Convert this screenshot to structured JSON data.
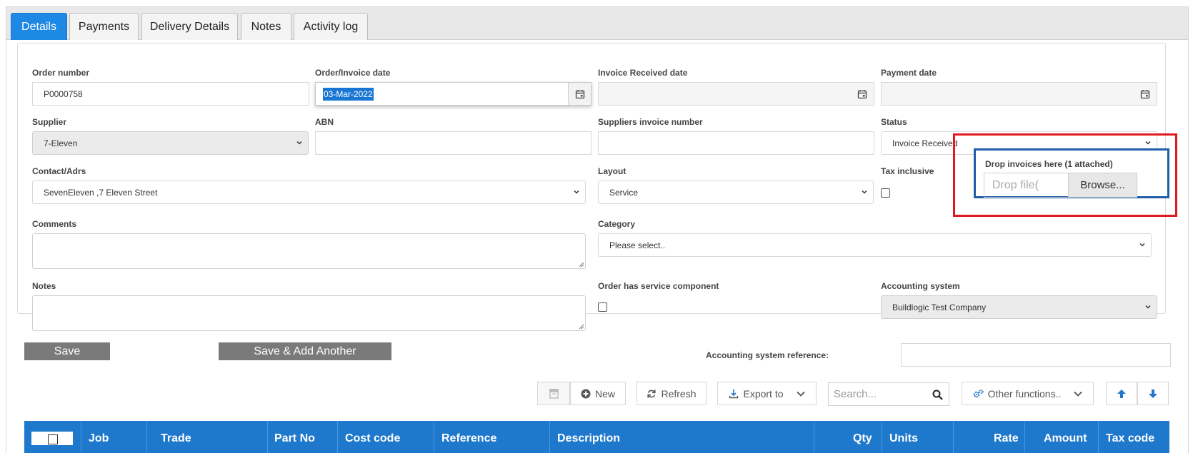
{
  "tabs": [
    "Details",
    "Payments",
    "Delivery Details",
    "Notes",
    "Activity log"
  ],
  "form": {
    "order_number": {
      "label": "Order number",
      "value": "P0000758"
    },
    "invoice_date": {
      "label": "Order/Invoice date",
      "value": "03-Mar-2022"
    },
    "received_date": {
      "label": "Invoice Received date",
      "value": ""
    },
    "payment_date": {
      "label": "Payment date",
      "value": ""
    },
    "supplier": {
      "label": "Supplier",
      "value": "7-Eleven"
    },
    "abn": {
      "label": "ABN",
      "value": ""
    },
    "supplier_invoice": {
      "label": "Suppliers invoice number",
      "value": ""
    },
    "status": {
      "label": "Status",
      "value": "Invoice Received"
    },
    "contact": {
      "label": "Contact/Adrs",
      "value": "SevenEleven ,7 Eleven Street"
    },
    "layout": {
      "label": "Layout",
      "value": "Service"
    },
    "tax_inclusive": {
      "label": "Tax inclusive"
    },
    "comments": {
      "label": "Comments"
    },
    "category": {
      "label": "Category",
      "value": "Please select.."
    },
    "notes": {
      "label": "Notes"
    },
    "service_component": {
      "label": "Order has service component"
    },
    "accounting_system": {
      "label": "Accounting system",
      "value": "Buildlogic Test Company"
    },
    "accounting_ref": {
      "label": "Accounting system reference:",
      "value": ""
    }
  },
  "drop": {
    "label": "Drop invoices here (1 attached)",
    "placeholder": "Drop file(",
    "browse": "Browse..."
  },
  "actions": {
    "save": "Save",
    "save_add": "Save & Add Another"
  },
  "toolbar": {
    "new": "New",
    "refresh": "Refresh",
    "export": "Export to",
    "search_placeholder": "Search...",
    "other": "Other functions.."
  },
  "grid": {
    "columns": [
      "Job",
      "Trade",
      "Part No",
      "Cost code",
      "Reference",
      "Description",
      "Qty",
      "Units",
      "Rate",
      "Amount",
      "Tax code"
    ]
  },
  "colors": {
    "accent": "#1e88e5",
    "grid_header": "#1e78cc",
    "highlight_red": "#e0191f",
    "highlight_blue": "#1e5fa8"
  }
}
